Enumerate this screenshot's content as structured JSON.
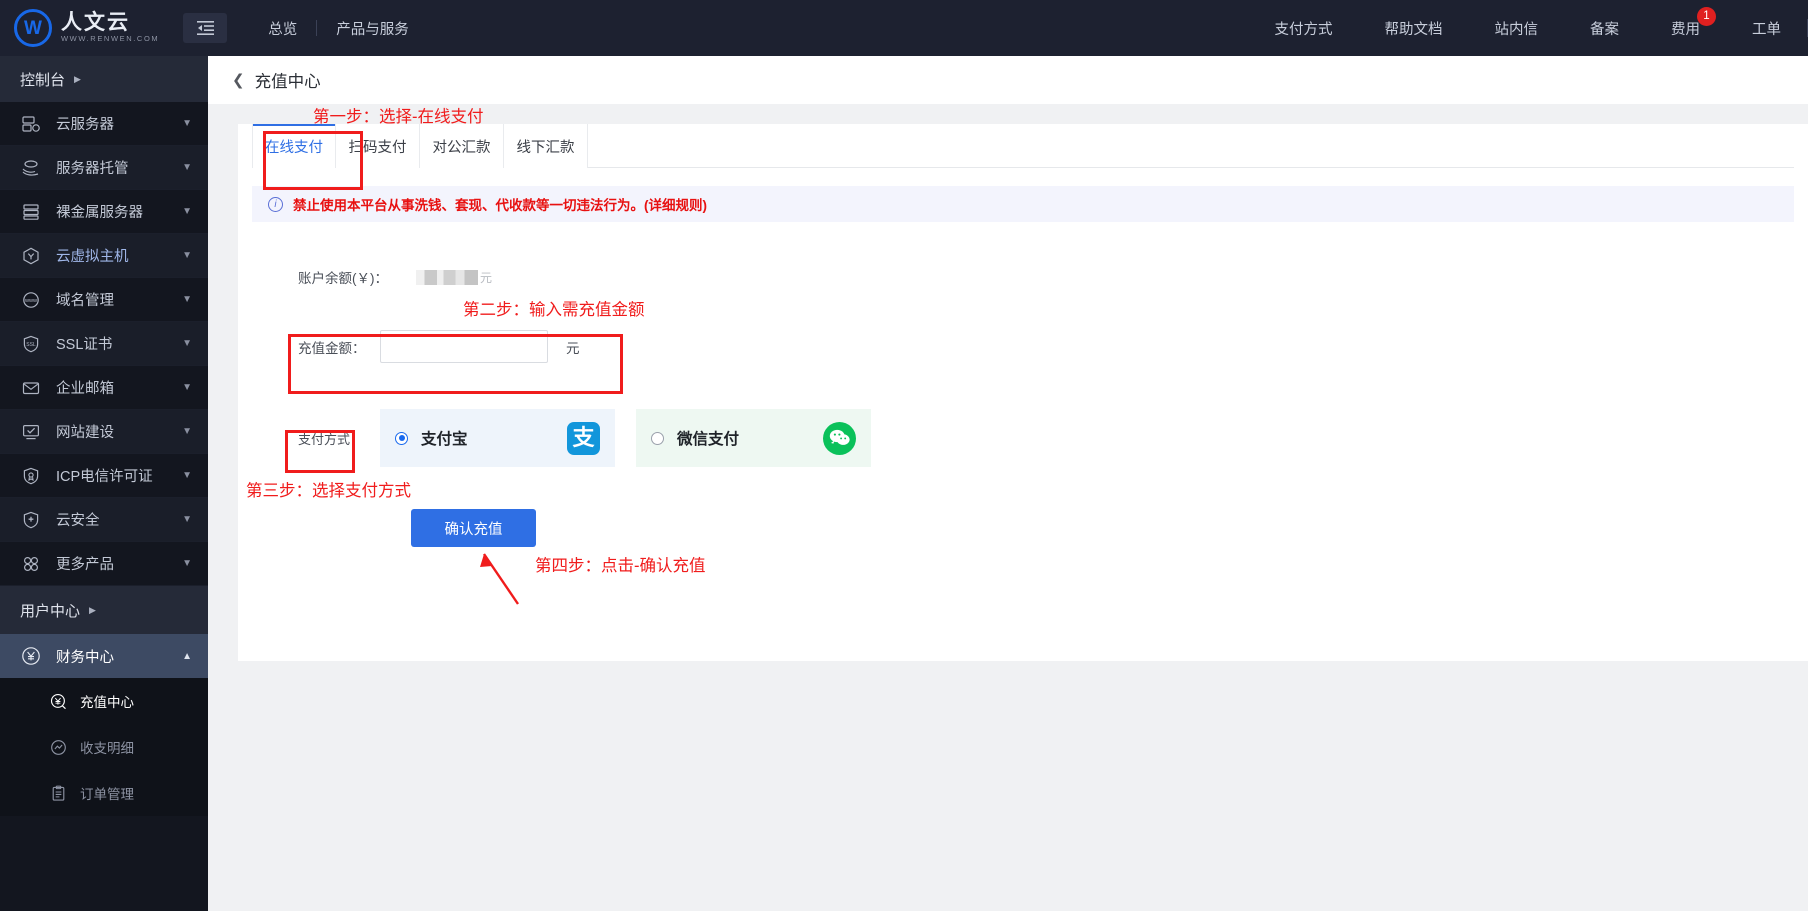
{
  "topbar": {
    "brand_cn": "人文云",
    "brand_en": "WWW.RENWEN.COM",
    "brand_initial": "W",
    "collapse_icon": "collapse-menu-icon",
    "left_nav": [
      {
        "label": "总览"
      },
      {
        "label": "产品与服务"
      }
    ],
    "right_nav": [
      {
        "label": "支付方式",
        "badge": ""
      },
      {
        "label": "帮助文档",
        "badge": ""
      },
      {
        "label": "站内信",
        "badge": ""
      },
      {
        "label": "备案",
        "badge": ""
      },
      {
        "label": "费用",
        "badge": "1"
      },
      {
        "label": "工单",
        "badge": ""
      }
    ]
  },
  "sidebar": {
    "console_label": "控制台",
    "items": [
      {
        "label": "云服务器",
        "icon": "server-icon",
        "chevron": "chevron-down"
      },
      {
        "label": "服务器托管",
        "icon": "hosting-hand-icon",
        "chevron": "chevron-down"
      },
      {
        "label": "裸金属服务器",
        "icon": "bare-metal-icon",
        "chevron": "chevron-down"
      },
      {
        "label": "云虚拟主机",
        "icon": "virtual-host-icon",
        "chevron": "chevron-down"
      },
      {
        "label": "域名管理",
        "icon": "www-globe-icon",
        "chevron": "chevron-down"
      },
      {
        "label": "SSL证书",
        "icon": "ssl-shield-icon",
        "chevron": "chevron-down"
      },
      {
        "label": "企业邮箱",
        "icon": "mail-icon",
        "chevron": "chevron-down"
      },
      {
        "label": "网站建设",
        "icon": "monitor-check-icon",
        "chevron": "chevron-down"
      },
      {
        "label": "ICP电信许可证",
        "icon": "license-shield-icon",
        "chevron": "chevron-down"
      },
      {
        "label": "云安全",
        "icon": "shield-plus-icon",
        "chevron": "chevron-down"
      },
      {
        "label": "更多产品",
        "icon": "grid-apps-icon",
        "chevron": "chevron-down"
      }
    ],
    "user_center_label": "用户中心",
    "finance": {
      "label": "财务中心",
      "icon": "yuan-circle-icon",
      "chevron": "chevron-up",
      "children": [
        {
          "label": "充值中心",
          "icon": "recharge-yuan-icon",
          "active": true
        },
        {
          "label": "收支明细",
          "icon": "trend-chart-icon",
          "active": false
        },
        {
          "label": "订单管理",
          "icon": "clipboard-icon",
          "active": false
        }
      ]
    }
  },
  "page": {
    "back_icon": "chevron-left-icon",
    "title": "充值中心"
  },
  "tabs": [
    {
      "label": "在线支付",
      "active": true
    },
    {
      "label": "扫码支付",
      "active": false
    },
    {
      "label": "对公汇款",
      "active": false
    },
    {
      "label": "线下汇款",
      "active": false
    }
  ],
  "notice": {
    "icon": "info-circle-icon",
    "text": "禁止使用本平台从事洗钱、套现、代收款等一切违法行为。(详细规则)"
  },
  "form": {
    "balance_label": "账户余额(￥)：",
    "balance_value": "",
    "balance_unit": "元",
    "amount_label": "充值金额：",
    "amount_value": "",
    "amount_placeholder": "",
    "amount_unit": "元",
    "pay_method_label": "支付方式：",
    "pay_options": [
      {
        "name": "支付宝",
        "logo": "alipay-logo-icon",
        "logo_glyph": "支",
        "selected": true
      },
      {
        "name": "微信支付",
        "logo": "wechat-pay-logo-icon",
        "logo_glyph": "",
        "selected": false
      }
    ],
    "submit_label": "确认充值"
  },
  "annotations": [
    {
      "id": "step1",
      "text": "第一步：选择-在线支付"
    },
    {
      "id": "step2",
      "text": "第二步：输入需充值金额"
    },
    {
      "id": "step3",
      "text": "第三步：选择支付方式"
    },
    {
      "id": "step4",
      "text": "第四步：点击-确认充值"
    }
  ],
  "colors": {
    "accent": "#2f6fe4",
    "annotation": "#f01c1c",
    "sidebar_bg": "#13161f",
    "topbar_bg": "#1d2130",
    "notice_text": "#e81111",
    "alipay": "#1296db",
    "wechat": "#0ac15a",
    "badge": "#e02020"
  }
}
